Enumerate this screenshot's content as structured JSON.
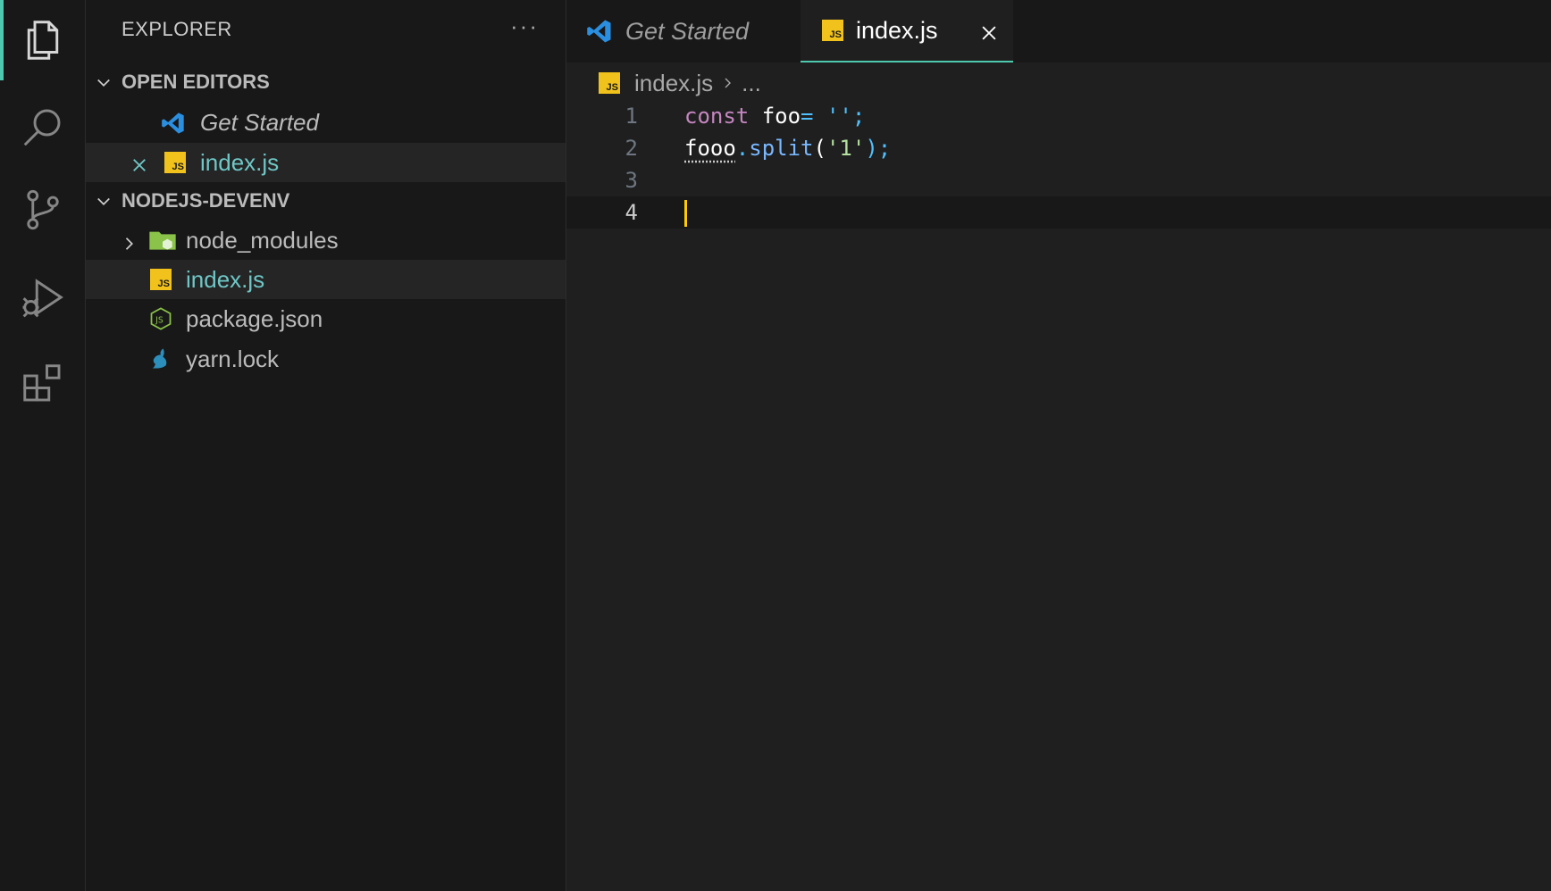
{
  "activity_bar": {
    "items": [
      {
        "name": "explorer",
        "icon": "files-icon",
        "active": true
      },
      {
        "name": "search",
        "icon": "search-icon",
        "active": false
      },
      {
        "name": "source-control",
        "icon": "source-control-icon",
        "active": false
      },
      {
        "name": "run-debug",
        "icon": "run-debug-icon",
        "active": false
      },
      {
        "name": "extensions",
        "icon": "extensions-icon",
        "active": false
      }
    ]
  },
  "sidebar": {
    "title": "EXPLORER",
    "more": "···",
    "open_editors": {
      "label": "OPEN EDITORS",
      "items": [
        {
          "label": "Get Started",
          "icon": "vscode-icon"
        },
        {
          "label": "index.js",
          "icon": "js-file-icon"
        }
      ]
    },
    "project": {
      "label": "NODEJS-DEVENV",
      "items": [
        {
          "label": "node_modules",
          "icon": "node-folder-icon"
        },
        {
          "label": "index.js",
          "icon": "js-file-icon"
        },
        {
          "label": "package.json",
          "icon": "nodejs-icon"
        },
        {
          "label": "yarn.lock",
          "icon": "yarn-icon"
        }
      ]
    }
  },
  "editor": {
    "tabs": [
      {
        "label": "Get Started",
        "icon": "vscode-icon"
      },
      {
        "label": "index.js",
        "icon": "js-file-icon"
      }
    ],
    "breadcrumb": {
      "file": "index.js",
      "rest": "..."
    },
    "js_badge": "JS",
    "lines": [
      {
        "number": "1"
      },
      {
        "number": "2"
      },
      {
        "number": "3"
      },
      {
        "number": "4"
      }
    ],
    "code": {
      "l1_kw": "const",
      "l1_id": " foo",
      "l1_op": "=",
      "l1_str": " ''",
      "l1_end": ";",
      "l2_id": "fooo",
      "l2_dot": ".",
      "l2_fn": "split",
      "l2_open": "(",
      "l2_str": "'1'",
      "l2_close": ");"
    }
  },
  "colors": {
    "accent": "#4ec9b0",
    "js_badge": "#f1c21b",
    "cursor": "#ffcc00",
    "vscode_blue": "#2a8fe0"
  }
}
